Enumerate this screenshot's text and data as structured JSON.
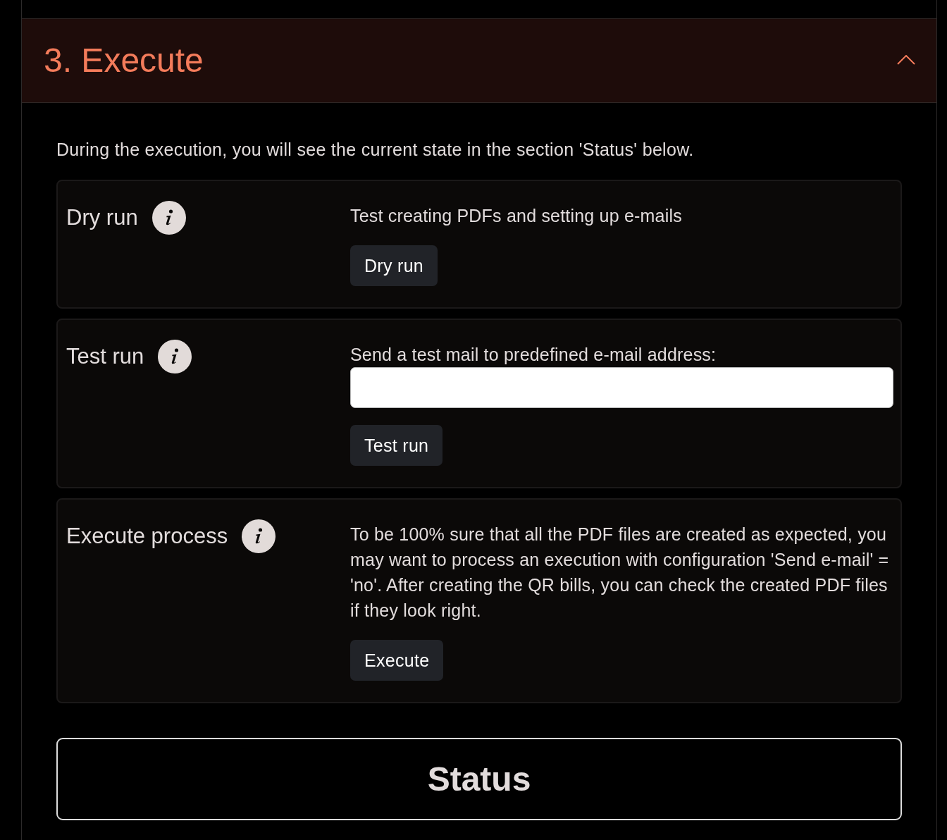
{
  "section": {
    "title": "3. Execute",
    "expanded": true
  },
  "intro": "During the execution, you will see the current state in the section 'Status' below.",
  "actions": [
    {
      "kind": "plain",
      "label": "Dry run",
      "description": "Test creating PDFs and setting up e-mails",
      "button": "Dry run"
    },
    {
      "kind": "email",
      "label": "Test run",
      "description": "Send a test mail to predefined e-mail address:",
      "button": "Test run"
    },
    {
      "kind": "plain",
      "label": "Execute process",
      "description": "To be 100% sure that all the PDF files are created as expected, you may want to process an execution with configuration 'Send e-mail' = 'no'. After creating the QR bills, you can check the created PDF files if they look right.",
      "button": "Execute"
    }
  ],
  "status": {
    "title": "Status"
  }
}
